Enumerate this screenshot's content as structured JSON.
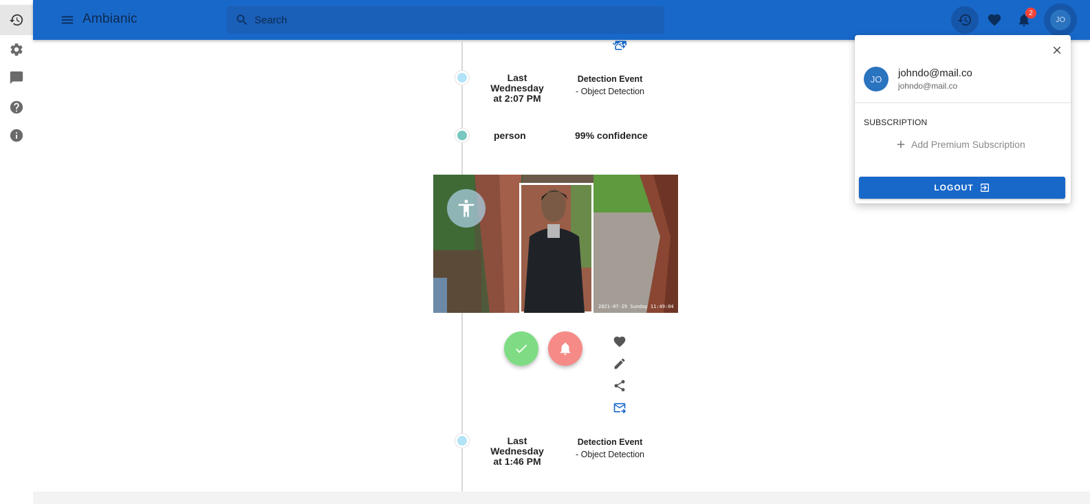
{
  "app": {
    "title": "Ambianic"
  },
  "search": {
    "placeholder": "Search"
  },
  "notifications": {
    "count": "2"
  },
  "user": {
    "initials": "JO",
    "name": "johndo@mail.co",
    "email": "johndo@mail.co"
  },
  "rail": {
    "items": [
      {
        "name": "history-icon",
        "active": true
      },
      {
        "name": "settings-icon",
        "active": false
      },
      {
        "name": "feedback-icon",
        "active": false
      },
      {
        "name": "help-icon",
        "active": false
      },
      {
        "name": "info-icon",
        "active": false
      }
    ]
  },
  "timeline": {
    "events": [
      {
        "time": "Last Wednesday at 2:07 PM",
        "type": "Detection Event",
        "subtype": "- Object Detection",
        "label": "person",
        "confidence": "99% confidence"
      },
      {
        "time": "Last Wednesday at 1:46 PM",
        "type": "Detection Event",
        "subtype": "- Object Detection"
      }
    ]
  },
  "popover": {
    "subscription_title": "SUBSCRIPTION",
    "add_subscription": "Add Premium Subscription",
    "logout": "LOGOUT"
  },
  "colors": {
    "appbar": "#1868c9",
    "accent": "#1868c9",
    "fab_ok": "#7fdc84",
    "fab_alert": "#f58a86",
    "badge": "#f44336"
  }
}
